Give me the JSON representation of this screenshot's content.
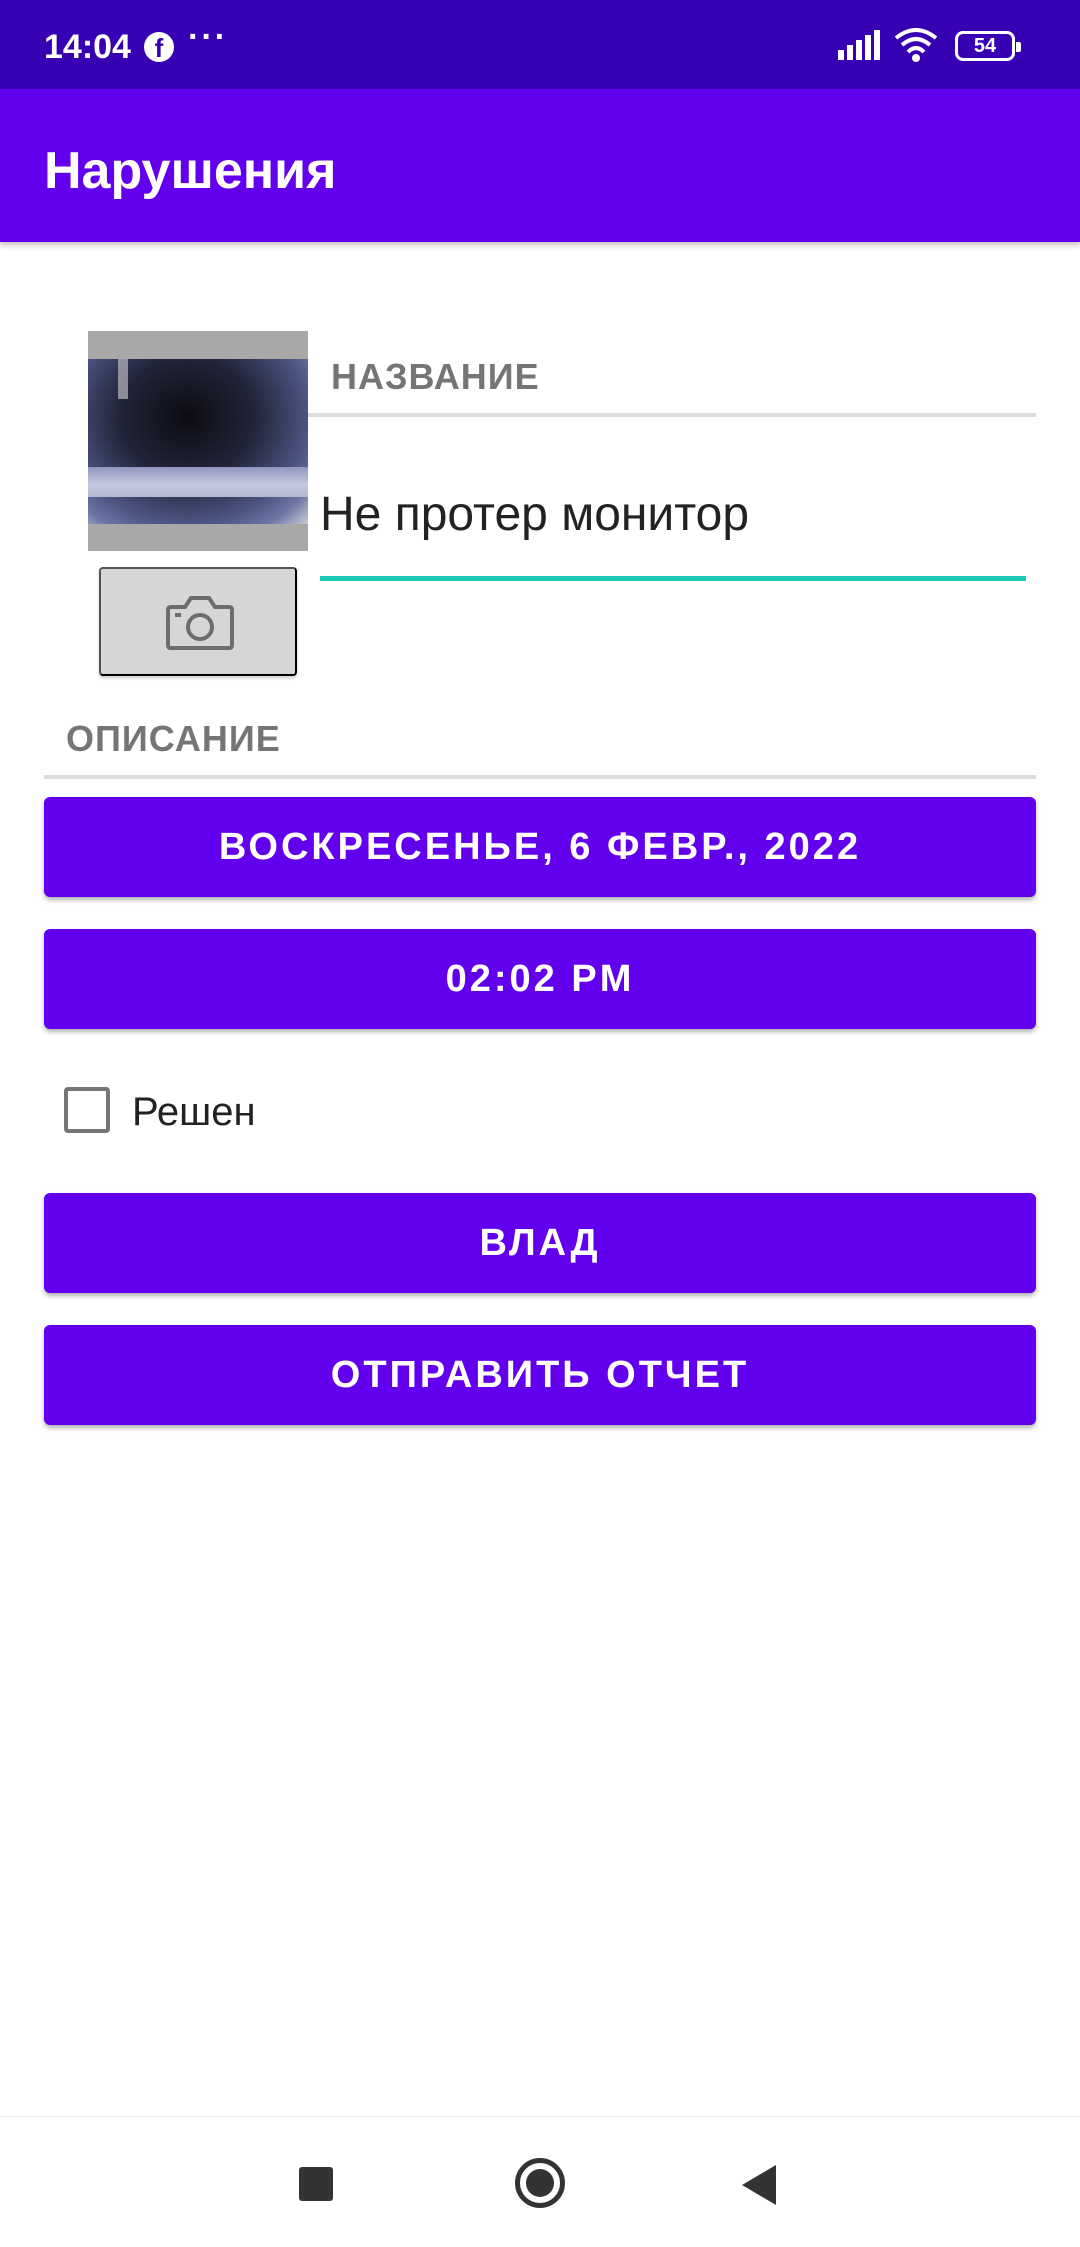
{
  "status_bar": {
    "time": "14:04",
    "battery": "54"
  },
  "app_bar": {
    "title": "Нарушения"
  },
  "form": {
    "title_label": "НАЗВАНИЕ",
    "title_value": "Не протер монитор",
    "description_label": "ОПИСАНИЕ",
    "date_button": "ВОСКРЕСЕНЬЕ, 6 ФЕВР., 2022",
    "time_button": "02:02 PM",
    "solved_label": "Решен",
    "solved_checked": false,
    "suspect_button": "ВЛАД",
    "report_button": "ОТПРАВИТЬ ОТЧЕТ"
  },
  "icons": {
    "camera": "camera-icon",
    "facebook": "facebook-icon",
    "signal": "signal-icon",
    "wifi": "wifi-icon",
    "battery": "battery-icon"
  },
  "colors": {
    "status_bar": "#3700b3",
    "primary": "#6200ee",
    "accent": "#1dc9b7"
  }
}
